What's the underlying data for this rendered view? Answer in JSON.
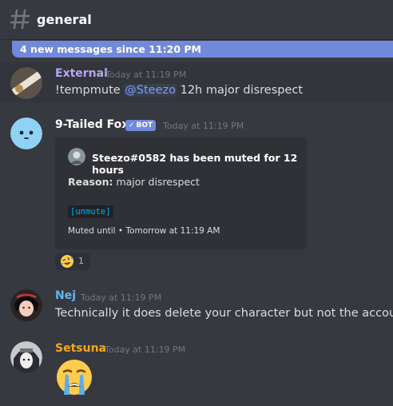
{
  "channel": {
    "name": "general"
  },
  "new_messages": {
    "label": "4 new messages since 11:20 PM"
  },
  "messages": [
    {
      "author": "External",
      "author_color": "#b9a5f0",
      "timestamp": "Today at 11:19 PM",
      "parts": {
        "a": "!tempmute ",
        "mention": "@Steezo",
        "b": " 12h major disrespect"
      }
    },
    {
      "author": "9-Tailed Fox",
      "author_color": "#ffffff",
      "badge": "BOT",
      "timestamp": "Today at 11:19 PM",
      "embed": {
        "author": "Steezo#0582 has been muted for 12 hours",
        "reason_label": "Reason:",
        "reason_value": "major disrespect",
        "code": "[unmute]",
        "footer": "Muted until • Tomorrow at 11:19 AM"
      },
      "reaction": {
        "emoji": "rolling-on-floor-laughing",
        "count": "1"
      }
    },
    {
      "author": "Nej",
      "author_color": "#5fb8f0",
      "timestamp": "Today at 11:19 PM",
      "text": "Technically it does delete your character but not the account"
    },
    {
      "author": "Setsuna",
      "author_color": "#f5a623",
      "timestamp": "Today at 11:19 PM",
      "emoji": "loudly-crying-face"
    }
  ]
}
